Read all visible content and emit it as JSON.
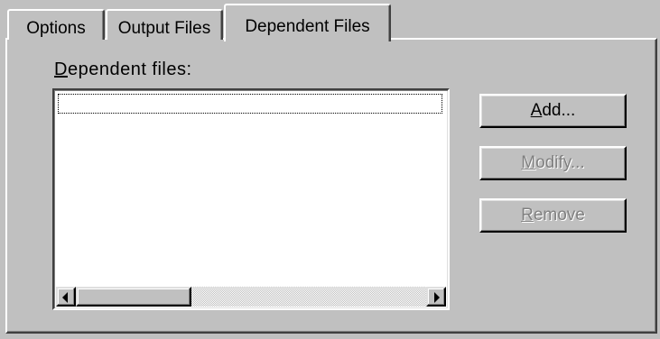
{
  "tabs": [
    {
      "label": "Options",
      "active": false
    },
    {
      "label": "Output Files",
      "active": false
    },
    {
      "label": "Dependent Files",
      "active": true
    }
  ],
  "panel": {
    "list_label_mnemonic": "D",
    "list_label_rest": "ependent files:",
    "list_items": []
  },
  "buttons": {
    "add": {
      "mnemonic": "A",
      "rest": "dd...",
      "enabled": true
    },
    "modify": {
      "mnemonic": "M",
      "rest": "odify...",
      "enabled": false
    },
    "remove": {
      "mnemonic": "R",
      "rest": "emove",
      "enabled": false
    }
  },
  "colors": {
    "face": "#c0c0c0",
    "highlight": "#ffffff",
    "shadow": "#808080",
    "dark_shadow": "#404040",
    "disabled_text": "#808080"
  },
  "icons": {
    "scroll_left": "triangle-left",
    "scroll_right": "triangle-right"
  }
}
